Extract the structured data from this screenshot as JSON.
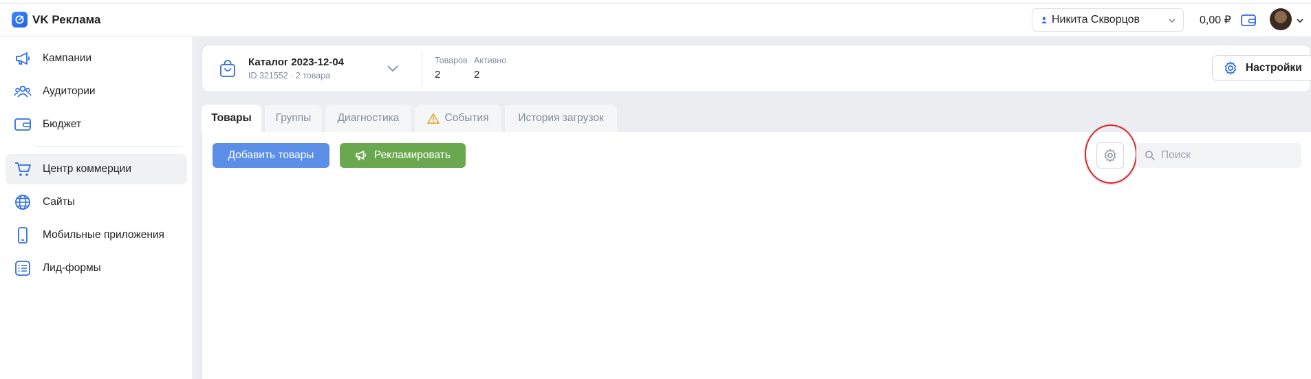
{
  "header": {
    "logo_text": "VK Реклама",
    "user_name": "Никита Скворцов",
    "balance": "0,00 ₽"
  },
  "sidebar": {
    "items": [
      {
        "label": "Кампании",
        "icon": "megaphone-icon"
      },
      {
        "label": "Аудитории",
        "icon": "users-icon"
      },
      {
        "label": "Бюджет",
        "icon": "wallet-icon"
      },
      {
        "label": "Центр коммерции",
        "icon": "cart-icon",
        "active": true
      },
      {
        "label": "Сайты",
        "icon": "globe-icon"
      },
      {
        "label": "Мобильные приложения",
        "icon": "smartphone-icon"
      },
      {
        "label": "Лид-формы",
        "icon": "list-icon"
      }
    ]
  },
  "catalog": {
    "title": "Каталог 2023-12-04",
    "subtitle": "ID 321552 · 2 товара",
    "stats": [
      {
        "label": "Товаров",
        "value": "2"
      },
      {
        "label": "Активно",
        "value": "2"
      }
    ],
    "settings_label": "Настройки"
  },
  "tabs": [
    {
      "label": "Товары",
      "active": true
    },
    {
      "label": "Группы"
    },
    {
      "label": "Диагностика"
    },
    {
      "label": "События",
      "icon": "warning-icon"
    },
    {
      "label": "История загрузок"
    }
  ],
  "toolbar": {
    "add_label": "Добавить товары",
    "promo_label": "Рекламировать",
    "search_placeholder": "Поиск"
  },
  "colors": {
    "accent_blue": "#5b8ee6",
    "accent_green": "#6aa84f",
    "warning": "#e8a634",
    "highlight_ring": "#d9262b"
  }
}
